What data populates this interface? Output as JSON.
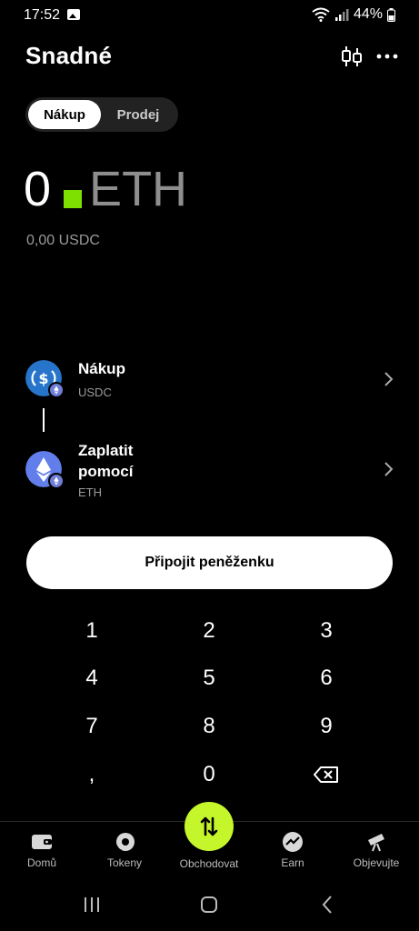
{
  "status_bar": {
    "time": "17:52",
    "battery": "44%"
  },
  "header": {
    "title": "Snadné"
  },
  "mode_toggle": {
    "active_label": "Nákup",
    "inactive_label": "Prodej"
  },
  "amount": {
    "value": "0",
    "unit": "ETH",
    "secondary": "0,00 USDC"
  },
  "buy_row": {
    "title": "Nákup",
    "token": "USDC"
  },
  "pay_row": {
    "title": "Zaplatit pomocí",
    "token": "ETH"
  },
  "connect_button": {
    "label": "Připojit peněženku"
  },
  "keypad": {
    "keys": [
      "1",
      "2",
      "3",
      "4",
      "5",
      "6",
      "7",
      "8",
      "9",
      ",",
      "0"
    ]
  },
  "bottom_nav": {
    "items": [
      "Domů",
      "Tokeny",
      "Obchodovat",
      "Earn",
      "Objevujte"
    ]
  },
  "colors": {
    "accent": "#c5f62b",
    "cursor": "#7ee000",
    "usdc": "#2775ca",
    "eth": "#627eea"
  }
}
